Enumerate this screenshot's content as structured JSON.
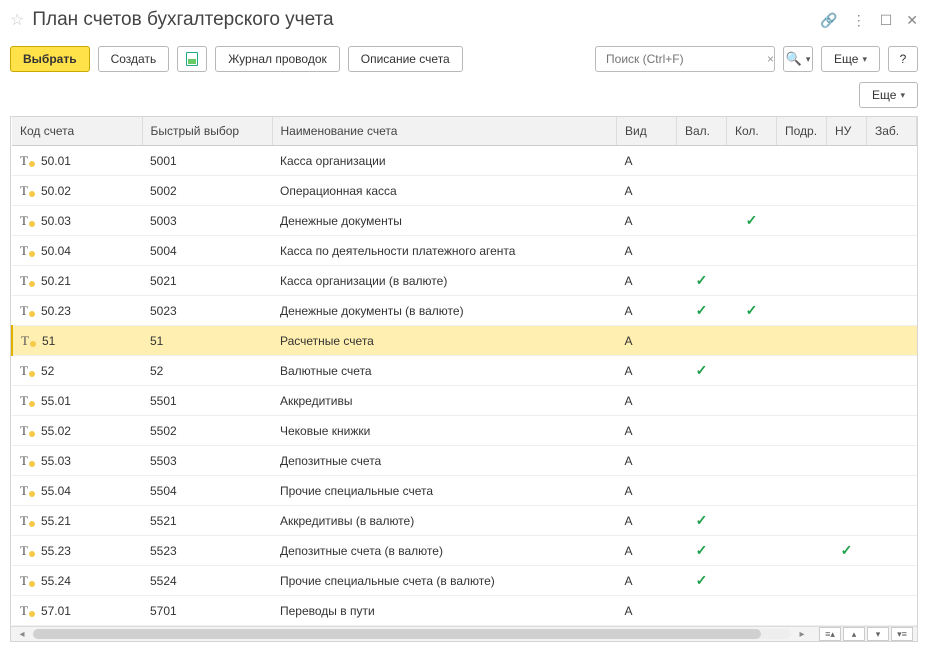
{
  "window": {
    "title": "План счетов бухгалтерского учета"
  },
  "toolbar": {
    "select": "Выбрать",
    "create": "Создать",
    "journal": "Журнал проводок",
    "description": "Описание счета",
    "search_placeholder": "Поиск (Ctrl+F)",
    "more": "Еще",
    "help": "?"
  },
  "secondary": {
    "more": "Еще"
  },
  "columns": {
    "code": "Код счета",
    "quick": "Быстрый выбор",
    "name": "Наименование счета",
    "kind": "Вид",
    "val": "Вал.",
    "qty": "Кол.",
    "sub": "Подр.",
    "nu": "НУ",
    "zab": "Заб."
  },
  "rows": [
    {
      "code": "50.01",
      "quick": "5001",
      "name": "Касса организации",
      "kind": "А",
      "val": false,
      "qty": false,
      "sub": false,
      "nu": false,
      "zab": false,
      "selected": false
    },
    {
      "code": "50.02",
      "quick": "5002",
      "name": "Операционная касса",
      "kind": "А",
      "val": false,
      "qty": false,
      "sub": false,
      "nu": false,
      "zab": false,
      "selected": false
    },
    {
      "code": "50.03",
      "quick": "5003",
      "name": "Денежные документы",
      "kind": "А",
      "val": false,
      "qty": true,
      "sub": false,
      "nu": false,
      "zab": false,
      "selected": false
    },
    {
      "code": "50.04",
      "quick": "5004",
      "name": "Касса по деятельности платежного агента",
      "kind": "А",
      "val": false,
      "qty": false,
      "sub": false,
      "nu": false,
      "zab": false,
      "selected": false
    },
    {
      "code": "50.21",
      "quick": "5021",
      "name": "Касса организации (в валюте)",
      "kind": "А",
      "val": true,
      "qty": false,
      "sub": false,
      "nu": false,
      "zab": false,
      "selected": false
    },
    {
      "code": "50.23",
      "quick": "5023",
      "name": "Денежные документы (в валюте)",
      "kind": "А",
      "val": true,
      "qty": true,
      "sub": false,
      "nu": false,
      "zab": false,
      "selected": false
    },
    {
      "code": "51",
      "quick": "51",
      "name": "Расчетные счета",
      "kind": "А",
      "val": false,
      "qty": false,
      "sub": false,
      "nu": false,
      "zab": false,
      "selected": true
    },
    {
      "code": "52",
      "quick": "52",
      "name": "Валютные счета",
      "kind": "А",
      "val": true,
      "qty": false,
      "sub": false,
      "nu": false,
      "zab": false,
      "selected": false
    },
    {
      "code": "55.01",
      "quick": "5501",
      "name": "Аккредитивы",
      "kind": "А",
      "val": false,
      "qty": false,
      "sub": false,
      "nu": false,
      "zab": false,
      "selected": false
    },
    {
      "code": "55.02",
      "quick": "5502",
      "name": "Чековые книжки",
      "kind": "А",
      "val": false,
      "qty": false,
      "sub": false,
      "nu": false,
      "zab": false,
      "selected": false
    },
    {
      "code": "55.03",
      "quick": "5503",
      "name": "Депозитные счета",
      "kind": "А",
      "val": false,
      "qty": false,
      "sub": false,
      "nu": false,
      "zab": false,
      "selected": false
    },
    {
      "code": "55.04",
      "quick": "5504",
      "name": "Прочие специальные счета",
      "kind": "А",
      "val": false,
      "qty": false,
      "sub": false,
      "nu": false,
      "zab": false,
      "selected": false
    },
    {
      "code": "55.21",
      "quick": "5521",
      "name": "Аккредитивы (в валюте)",
      "kind": "А",
      "val": true,
      "qty": false,
      "sub": false,
      "nu": false,
      "zab": false,
      "selected": false
    },
    {
      "code": "55.23",
      "quick": "5523",
      "name": "Депозитные счета (в валюте)",
      "kind": "А",
      "val": true,
      "qty": false,
      "sub": false,
      "nu": true,
      "zab": false,
      "selected": false
    },
    {
      "code": "55.24",
      "quick": "5524",
      "name": "Прочие специальные счета (в валюте)",
      "kind": "А",
      "val": true,
      "qty": false,
      "sub": false,
      "nu": false,
      "zab": false,
      "selected": false
    },
    {
      "code": "57.01",
      "quick": "5701",
      "name": "Переводы в пути",
      "kind": "А",
      "val": false,
      "qty": false,
      "sub": false,
      "nu": false,
      "zab": false,
      "selected": false
    }
  ]
}
